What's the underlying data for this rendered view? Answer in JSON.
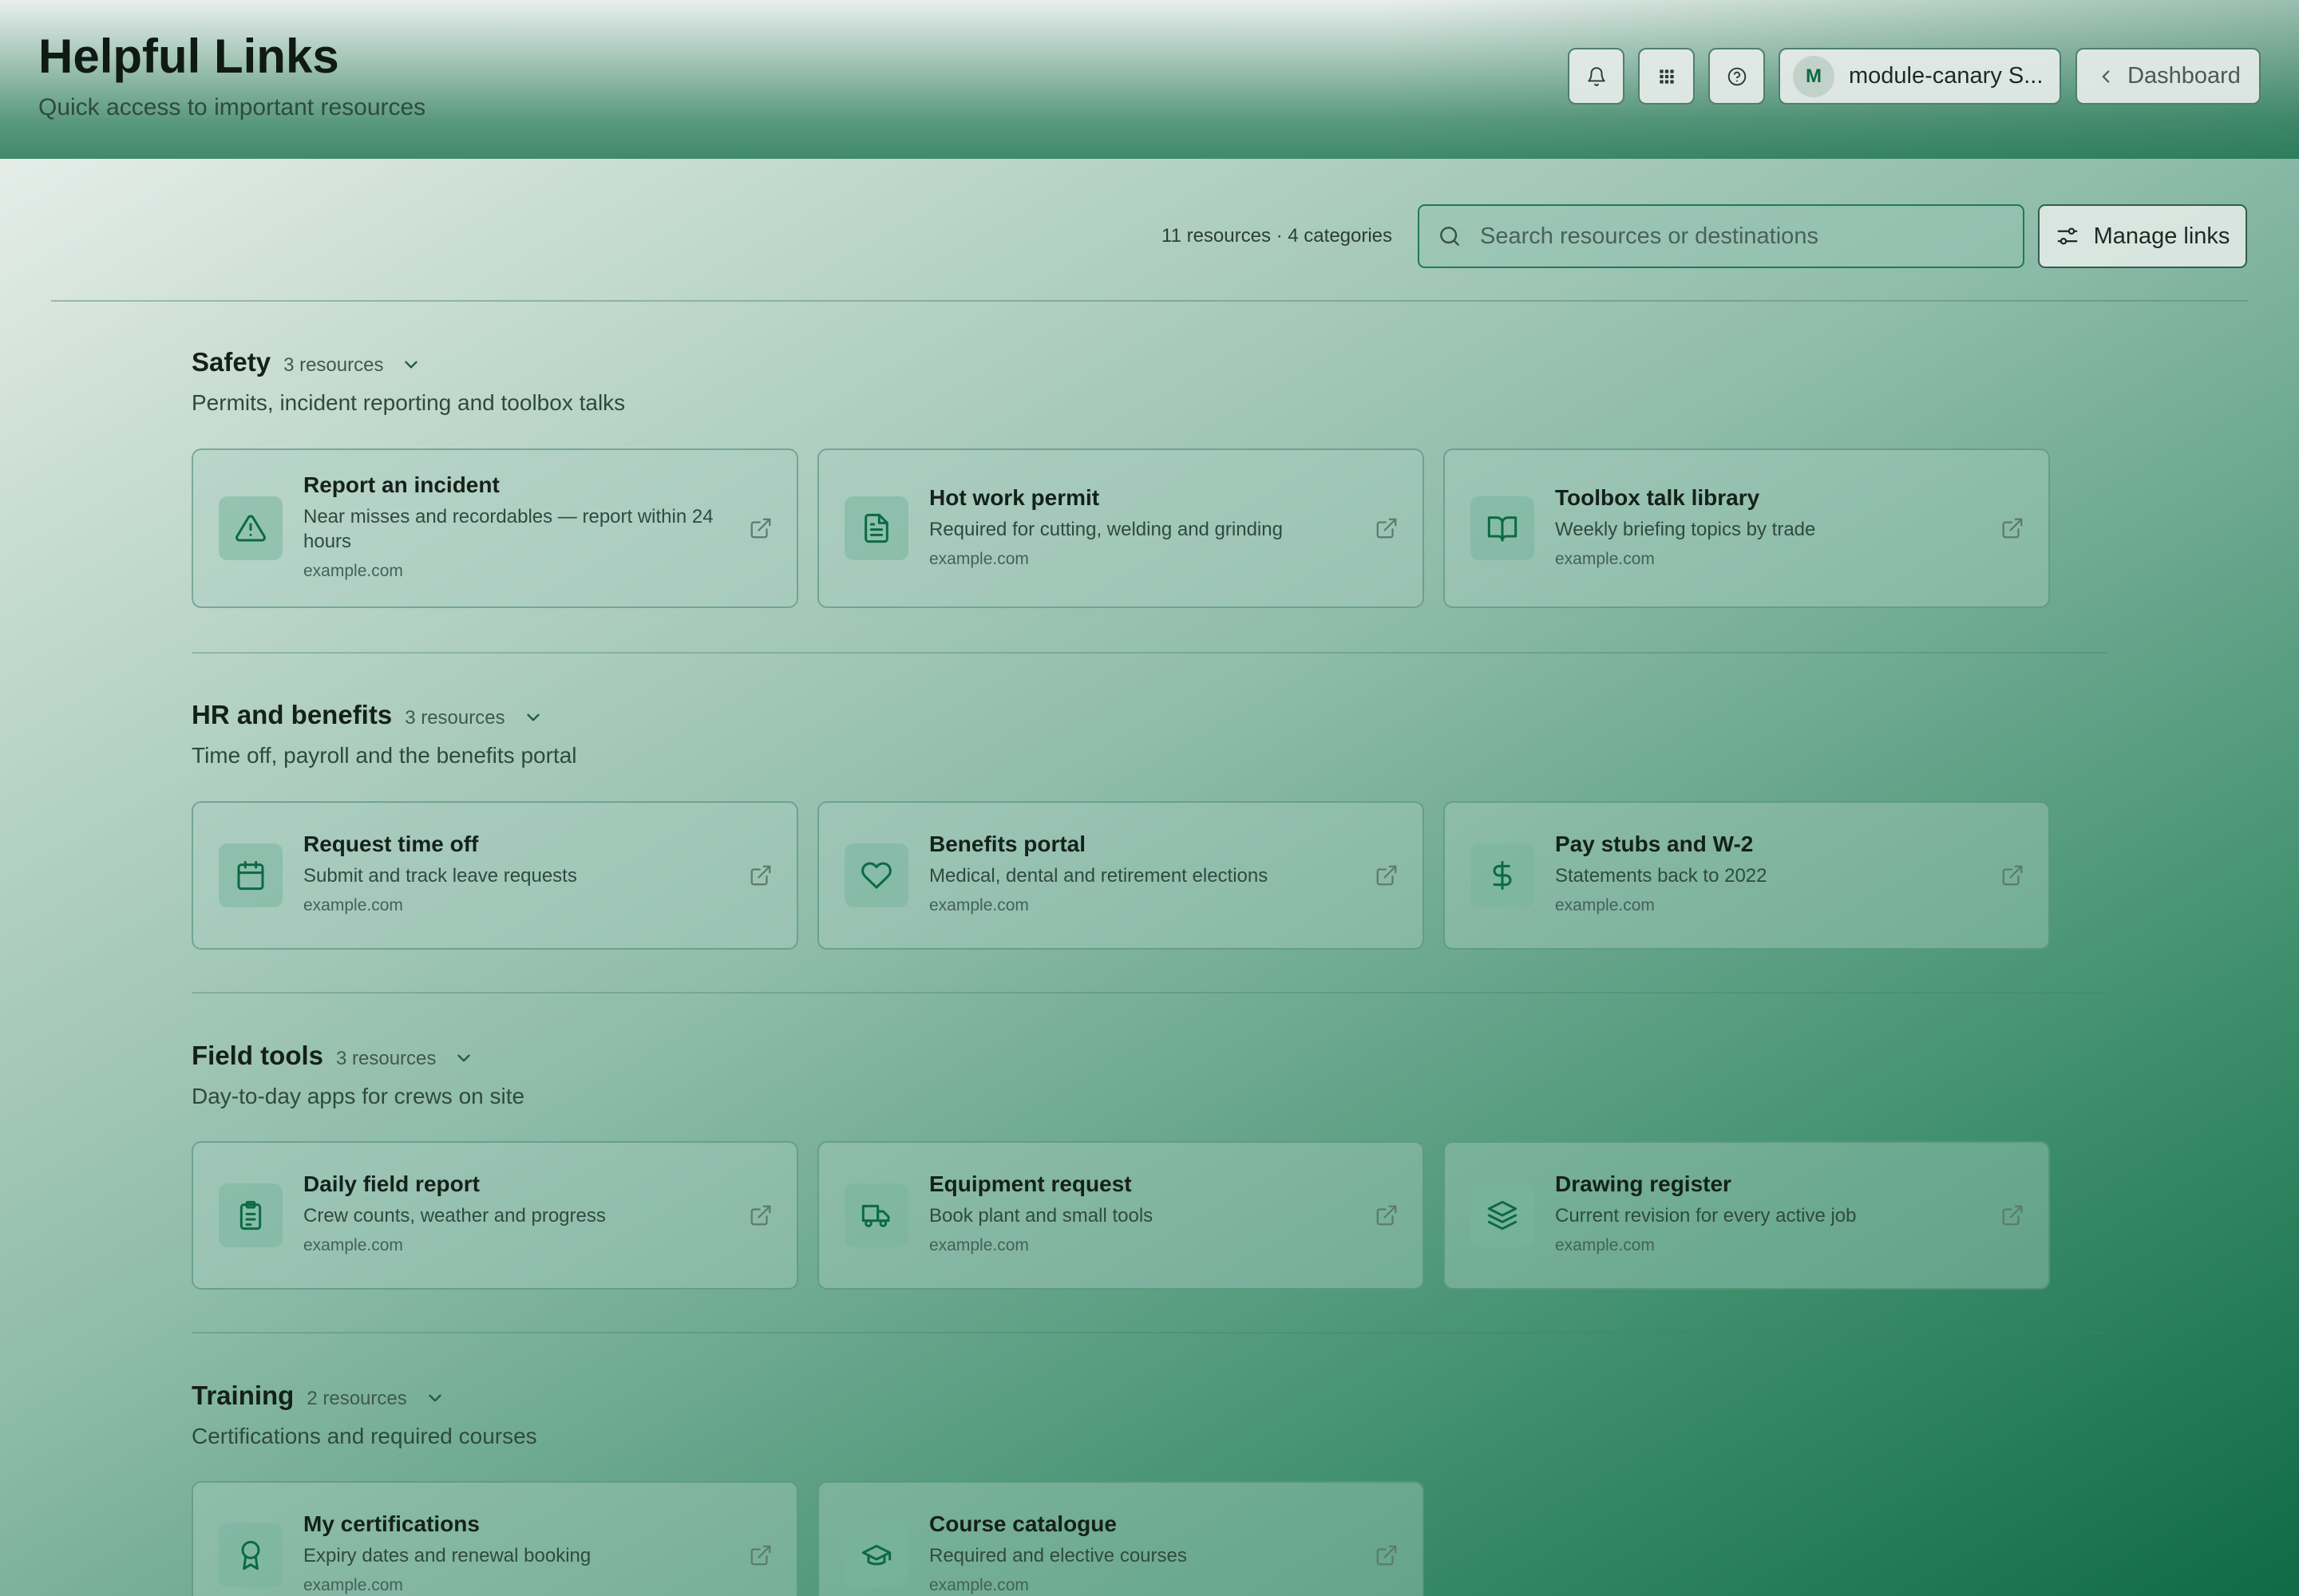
{
  "header": {
    "title": "Helpful Links",
    "subtitle": "Quick access to important resources",
    "icons": [
      "bell-icon",
      "apps-grid-icon",
      "help-icon"
    ],
    "account": {
      "initial": "M",
      "label": "module-canary S..."
    },
    "back_label": "Dashboard"
  },
  "toolbar": {
    "counts": "11 resources · 4 categories",
    "search_placeholder": "Search resources or destinations",
    "manage_label": "Manage links"
  },
  "colors": {
    "accent": "#0b6a45",
    "border_focus": "#1f7a55"
  },
  "sections": [
    {
      "title": "Safety",
      "count": "3 resources",
      "description": "Permits, incident reporting and toolbox talks",
      "cards": [
        {
          "title": "Report an incident",
          "description": "Near misses and recordables — report within 24 hours",
          "url": "example.com",
          "icon": "alert-triangle-icon"
        },
        {
          "title": "Hot work permit",
          "description": "Required for cutting, welding and grinding",
          "url": "example.com",
          "icon": "document-icon"
        },
        {
          "title": "Toolbox talk library",
          "description": "Weekly briefing topics by trade",
          "url": "example.com",
          "icon": "book-open-icon"
        }
      ]
    },
    {
      "title": "HR and benefits",
      "count": "3 resources",
      "description": "Time off, payroll and the benefits portal",
      "cards": [
        {
          "title": "Request time off",
          "description": "Submit and track leave requests",
          "url": "example.com",
          "icon": "calendar-icon"
        },
        {
          "title": "Benefits portal",
          "description": "Medical, dental and retirement elections",
          "url": "example.com",
          "icon": "heart-icon"
        },
        {
          "title": "Pay stubs and W-2",
          "description": "Statements back to 2022",
          "url": "example.com",
          "icon": "dollar-icon"
        }
      ]
    },
    {
      "title": "Field tools",
      "count": "3 resources",
      "description": "Day-to-day apps for crews on site",
      "cards": [
        {
          "title": "Daily field report",
          "description": "Crew counts, weather and progress",
          "url": "example.com",
          "icon": "clipboard-icon"
        },
        {
          "title": "Equipment request",
          "description": "Book plant and small tools",
          "url": "example.com",
          "icon": "truck-icon"
        },
        {
          "title": "Drawing register",
          "description": "Current revision for every active job",
          "url": "example.com",
          "icon": "layers-icon"
        }
      ]
    },
    {
      "title": "Training",
      "count": "2 resources",
      "description": "Certifications and required courses",
      "cards": [
        {
          "title": "My certifications",
          "description": "Expiry dates and renewal booking",
          "url": "example.com",
          "icon": "award-icon"
        },
        {
          "title": "Course catalogue",
          "description": "Required and elective courses",
          "url": "example.com",
          "icon": "graduation-cap-icon"
        }
      ]
    }
  ]
}
